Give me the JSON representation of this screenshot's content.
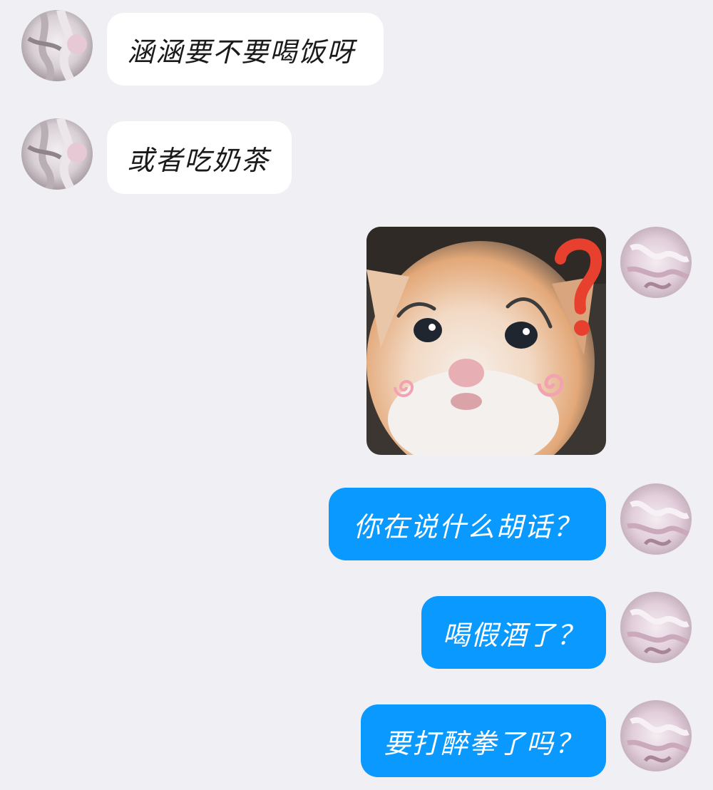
{
  "messages": [
    {
      "side": "received",
      "type": "text",
      "text": "涵涵要不要喝饭呀",
      "avatar": "avatar-pink-knot"
    },
    {
      "side": "received",
      "type": "text",
      "text": "或者吃奶茶",
      "avatar": "avatar-pink-knot"
    },
    {
      "side": "sent",
      "type": "sticker",
      "sticker": "confused-kitten-sticker",
      "avatar": "avatar-pink-yarn"
    },
    {
      "side": "sent",
      "type": "text",
      "text": "你在说什么胡话？",
      "avatar": "avatar-pink-yarn"
    },
    {
      "side": "sent",
      "type": "text",
      "text": "喝假酒了？",
      "avatar": "avatar-pink-yarn"
    },
    {
      "side": "sent",
      "type": "text",
      "text": "要打醉拳了吗？",
      "avatar": "avatar-pink-yarn"
    }
  ],
  "colors": {
    "background": "#efeff4",
    "received_bubble": "#ffffff",
    "sent_bubble": "#0a99ff",
    "sticker_question_mark": "#e8402e"
  }
}
